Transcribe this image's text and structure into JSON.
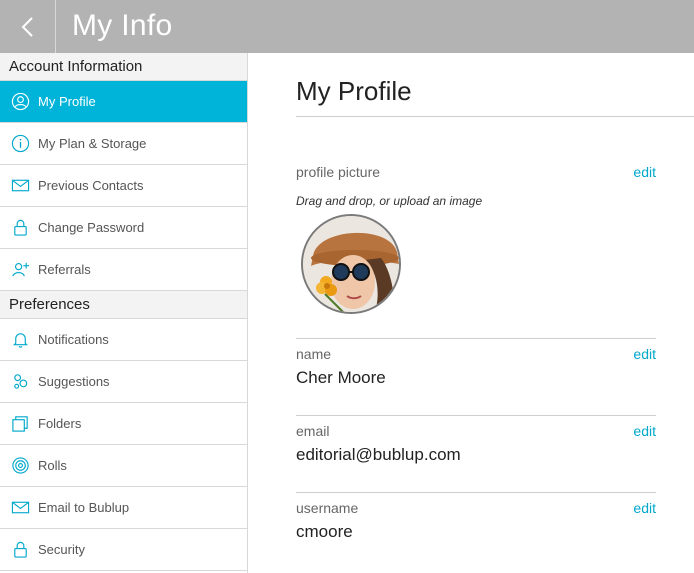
{
  "header": {
    "title": "My Info",
    "back_icon": "chevron-left-icon"
  },
  "sidebar": {
    "sections": [
      {
        "title": "Account Information",
        "items": [
          {
            "label": "My Profile",
            "icon": "user-circle-icon",
            "active": true
          },
          {
            "label": "My Plan & Storage",
            "icon": "info-icon",
            "active": false
          },
          {
            "label": "Previous Contacts",
            "icon": "envelope-icon",
            "active": false
          },
          {
            "label": "Change Password",
            "icon": "lock-icon",
            "active": false
          },
          {
            "label": "Referrals",
            "icon": "add-user-icon",
            "active": false
          }
        ]
      },
      {
        "title": "Preferences",
        "items": [
          {
            "label": "Notifications",
            "icon": "bell-icon",
            "active": false
          },
          {
            "label": "Suggestions",
            "icon": "bubbles-icon",
            "active": false
          },
          {
            "label": "Folders",
            "icon": "folders-icon",
            "active": false
          },
          {
            "label": "Rolls",
            "icon": "spiral-icon",
            "active": false
          },
          {
            "label": "Email to Bublup",
            "icon": "envelope-icon",
            "active": false
          },
          {
            "label": "Security",
            "icon": "lock-icon",
            "active": false
          }
        ]
      }
    ]
  },
  "main": {
    "title": "My Profile",
    "profile_picture": {
      "label": "profile picture",
      "edit": "edit",
      "hint": "Drag and drop, or upload an image"
    },
    "name": {
      "label": "name",
      "edit": "edit",
      "value": "Cher Moore"
    },
    "email": {
      "label": "email",
      "edit": "edit",
      "value": "editorial@bublup.com"
    },
    "username": {
      "label": "username",
      "edit": "edit",
      "value": "cmoore"
    }
  },
  "colors": {
    "accent": "#00b3d8",
    "link": "#00a8cc",
    "topbar": "#b3b3b3"
  }
}
